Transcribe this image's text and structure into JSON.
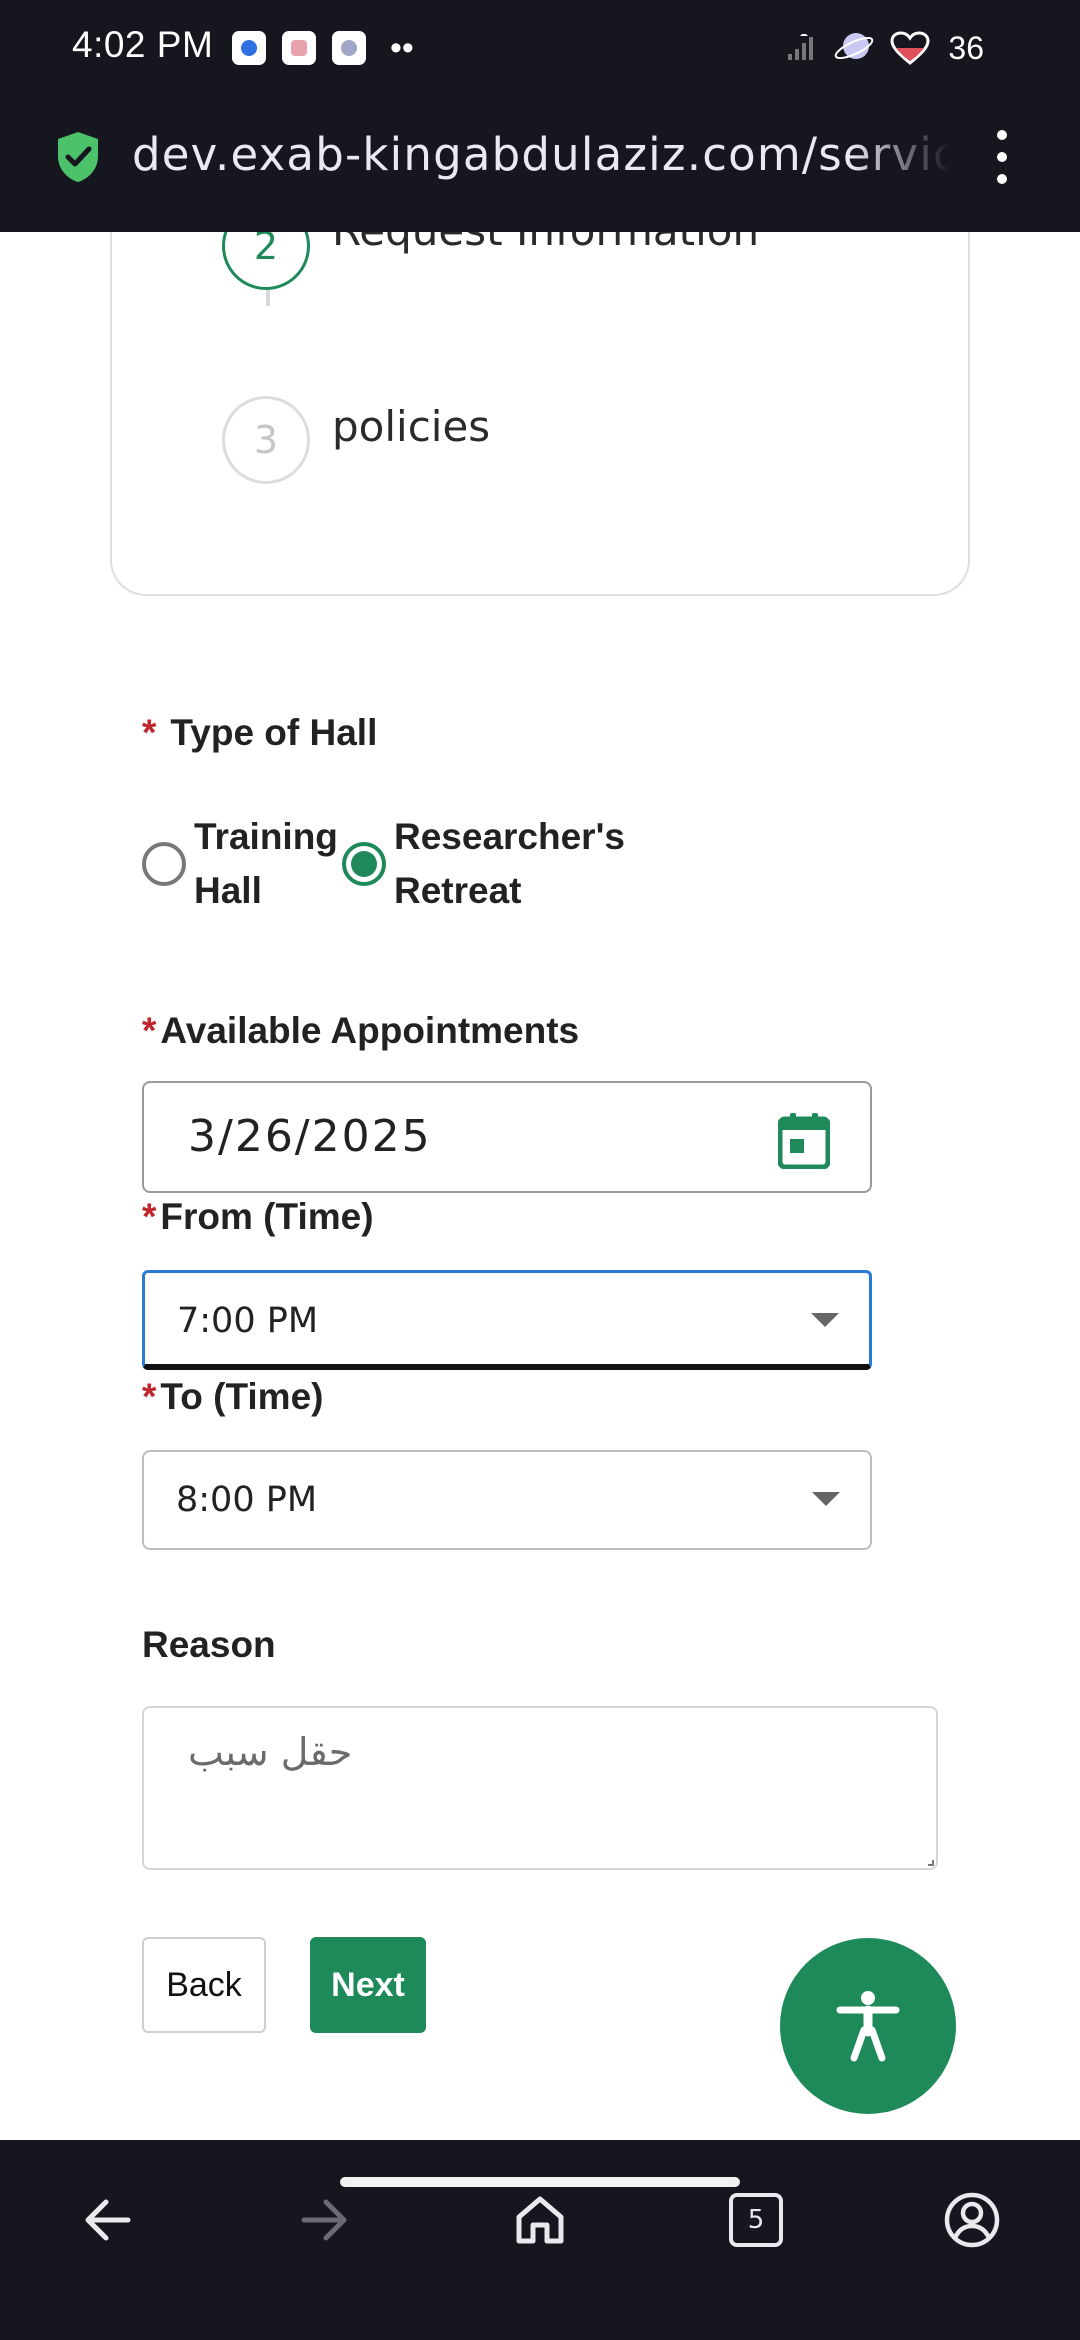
{
  "status_bar": {
    "time": "4:02 PM",
    "more_indicator": "••",
    "battery": "36",
    "notification_icons": [
      "messenger-icon",
      "photo-app-icon",
      "brain-app-icon"
    ]
  },
  "browser": {
    "url": "dev.exab-kingabdulaziz.com/services",
    "secure": true
  },
  "stepper": {
    "steps": [
      {
        "number": "2",
        "label": "Request Information",
        "state": "active"
      },
      {
        "number": "3",
        "label": "policies",
        "state": "pending"
      }
    ]
  },
  "form": {
    "hall_type": {
      "required_mark": "*",
      "label": "Type of Hall",
      "options": [
        {
          "label": "Training Hall",
          "selected": false
        },
        {
          "label": "Researcher's Retreat",
          "selected": true
        }
      ]
    },
    "appointment": {
      "required_mark": "*",
      "label": "Available Appointments",
      "date_value": "3/26/2025"
    },
    "from_time": {
      "required_mark": "*",
      "label": "From (Time)",
      "value": "7:00 PM"
    },
    "to_time": {
      "required_mark": "*",
      "label": "To (Time)",
      "value": "8:00 PM"
    },
    "reason": {
      "label": "Reason",
      "placeholder": "حقل سبب",
      "value": ""
    },
    "back_label": "Back",
    "next_label": "Next"
  },
  "bottom_nav": {
    "tab_count": "5",
    "items": [
      "back-arrow-icon",
      "forward-arrow-icon",
      "home-icon",
      "tabs-icon",
      "account-icon"
    ]
  },
  "colors": {
    "accent": "#1e8a5a",
    "required": "#c0262c",
    "chrome_bg": "#15161e",
    "focus": "#2a7bd4"
  }
}
